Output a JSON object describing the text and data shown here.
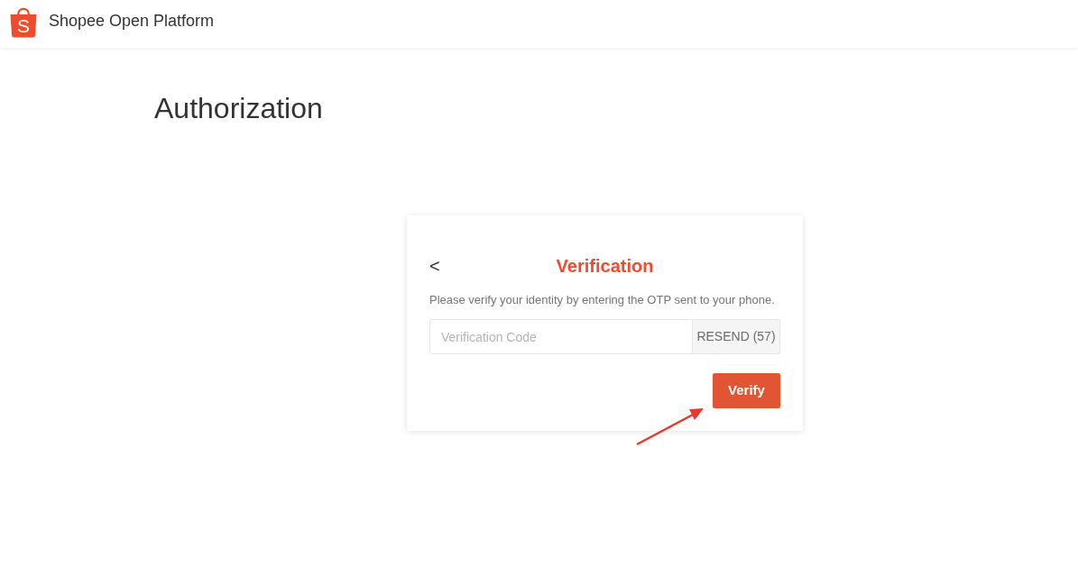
{
  "header": {
    "logo_letter": "S",
    "title": "Shopee Open Platform"
  },
  "page": {
    "title": "Authorization"
  },
  "card": {
    "back": "<",
    "title": "Verification",
    "description": "Please verify your identity by entering the OTP sent to your phone.",
    "code_field": {
      "placeholder": "Verification Code"
    },
    "resend_button": {
      "label": "RESEND (57)",
      "disabled": true
    },
    "verify_button": {
      "label": "Verify"
    }
  }
}
